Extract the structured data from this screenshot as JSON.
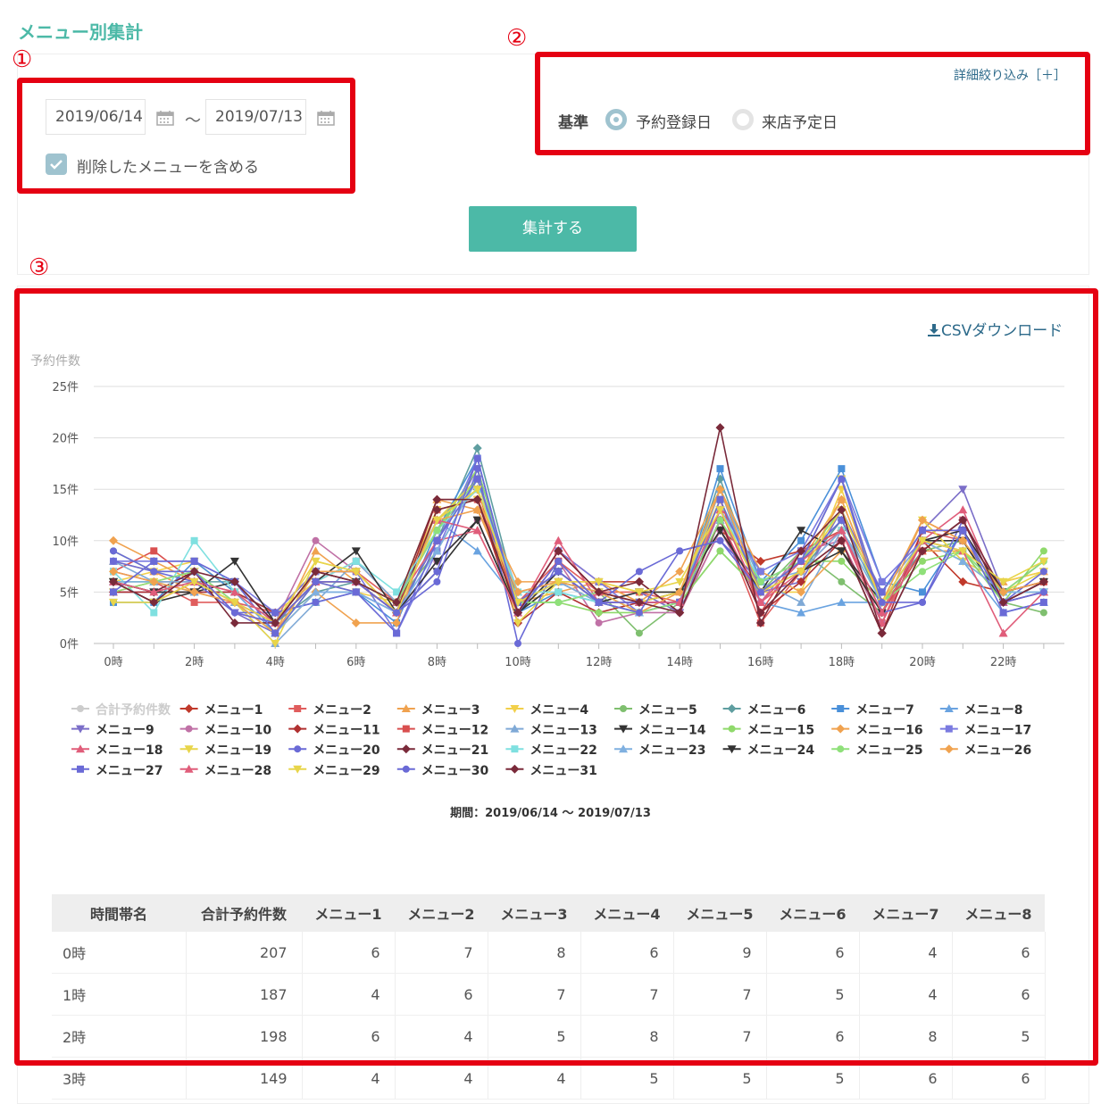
{
  "page": {
    "title": "メニュー別集計"
  },
  "annotations": [
    "①",
    "②",
    "③"
  ],
  "filters": {
    "start_date": "2019/06/14",
    "end_date": "2019/07/13",
    "separator": "〜",
    "include_deleted_label": "削除したメニューを含める",
    "include_deleted_checked": true,
    "detail_link": "詳細絞り込み［＋］",
    "basis_label": "基準",
    "basis_options": [
      "予約登録日",
      "来店予定日"
    ],
    "basis_selected": "予約登録日",
    "submit_label": "集計する"
  },
  "csv_link": "CSVダウンロード",
  "colors": {
    "accent": "#4cb9a7",
    "annotation": "#e50012",
    "link": "#2d6a8a"
  },
  "chart_data": {
    "type": "line",
    "ylabel": "予約件数",
    "ytick_labels": [
      "0件",
      "5件",
      "10件",
      "15件",
      "20件",
      "25件"
    ],
    "ylim": [
      0,
      25
    ],
    "x_categories": [
      "0時",
      "1時",
      "2時",
      "3時",
      "4時",
      "5時",
      "6時",
      "7時",
      "8時",
      "9時",
      "10時",
      "11時",
      "12時",
      "13時",
      "14時",
      "15時",
      "16時",
      "17時",
      "18時",
      "19時",
      "20時",
      "21時",
      "22時",
      "23時"
    ],
    "xtick_labels": [
      "0時",
      "2時",
      "4時",
      "6時",
      "8時",
      "10時",
      "12時",
      "14時",
      "16時",
      "18時",
      "20時",
      "22時"
    ],
    "grid": true,
    "legend_position": "bottom",
    "period_label": "期間：2019/06/14 〜 2019/07/13",
    "series": [
      {
        "name": "合計予約件数",
        "color": "#cccccc",
        "marker": "circle",
        "values": []
      },
      {
        "name": "メニュー1",
        "color": "#c0392b",
        "marker": "diamond",
        "values": [
          6,
          4,
          6,
          4,
          2,
          6,
          6,
          3,
          12,
          15,
          3,
          9,
          6,
          6,
          3,
          11,
          8,
          9,
          11,
          2,
          10,
          6,
          5,
          6
        ]
      },
      {
        "name": "メニュー2",
        "color": "#e05d5d",
        "marker": "square",
        "values": [
          7,
          6,
          4,
          4,
          3,
          7,
          7,
          4,
          13,
          14,
          4,
          8,
          5,
          5,
          4,
          12,
          2,
          7,
          10,
          2,
          11,
          10,
          4,
          6
        ]
      },
      {
        "name": "メニュー3",
        "color": "#f0a24f",
        "marker": "triangle",
        "values": [
          8,
          7,
          5,
          4,
          1,
          9,
          6,
          4,
          14,
          13,
          4,
          5,
          6,
          4,
          5,
          13,
          5,
          8,
          14,
          4,
          9,
          9,
          6,
          7
        ]
      },
      {
        "name": "メニュー4",
        "color": "#f2d04a",
        "marker": "triangle-down",
        "values": [
          6,
          7,
          8,
          5,
          3,
          6,
          5,
          4,
          13,
          14,
          3,
          6,
          6,
          5,
          5,
          14,
          5,
          5,
          15,
          4,
          10,
          8,
          6,
          7
        ]
      },
      {
        "name": "メニュー5",
        "color": "#7fbf6f",
        "marker": "circle",
        "values": [
          9,
          7,
          7,
          4,
          2,
          6,
          6,
          4,
          9,
          16,
          4,
          4,
          5,
          1,
          4,
          9,
          5,
          9,
          6,
          3,
          9,
          10,
          4,
          3
        ]
      },
      {
        "name": "メニュー6",
        "color": "#5f9ea0",
        "marker": "diamond",
        "values": [
          6,
          5,
          6,
          6,
          2,
          5,
          6,
          3,
          10,
          19,
          4,
          7,
          4,
          3,
          4,
          16,
          5,
          7,
          12,
          4,
          9,
          12,
          4,
          6
        ]
      },
      {
        "name": "メニュー7",
        "color": "#4a90d9",
        "marker": "square",
        "values": [
          4,
          4,
          8,
          5,
          3,
          4,
          5,
          2,
          11,
          18,
          3,
          5,
          4,
          4,
          4,
          17,
          6,
          10,
          17,
          6,
          5,
          11,
          4,
          5
        ]
      },
      {
        "name": "メニュー8",
        "color": "#6aa3e0",
        "marker": "triangle",
        "values": [
          6,
          6,
          5,
          5,
          1,
          5,
          5,
          3,
          12,
          9,
          4,
          6,
          4,
          3,
          4,
          15,
          4,
          3,
          4,
          4,
          10,
          8,
          3,
          4
        ]
      },
      {
        "name": "メニュー9",
        "color": "#7b6ec8",
        "marker": "triangle-down",
        "values": [
          5,
          5,
          7,
          3,
          1,
          7,
          7,
          3,
          10,
          17,
          4,
          7,
          4,
          5,
          3,
          13,
          5,
          6,
          13,
          5,
          11,
          15,
          5,
          5
        ]
      },
      {
        "name": "メニュー10",
        "color": "#c071a6",
        "marker": "circle",
        "values": [
          7,
          6,
          6,
          3,
          2,
          10,
          7,
          3,
          8,
          12,
          3,
          8,
          2,
          3,
          3,
          11,
          4,
          9,
          10,
          2,
          10,
          9,
          4,
          5
        ]
      },
      {
        "name": "メニュー11",
        "color": "#b03030",
        "marker": "diamond",
        "values": [
          5,
          5,
          5,
          5,
          3,
          7,
          7,
          3,
          14,
          14,
          2,
          5,
          3,
          4,
          4,
          12,
          3,
          6,
          10,
          1,
          11,
          11,
          5,
          6
        ]
      },
      {
        "name": "メニュー12",
        "color": "#d94f4f",
        "marker": "square",
        "values": [
          7,
          9,
          6,
          4,
          2,
          6,
          8,
          4,
          11,
          15,
          3,
          8,
          4,
          3,
          4,
          14,
          3,
          9,
          11,
          3,
          9,
          12,
          4,
          6
        ]
      },
      {
        "name": "メニュー13",
        "color": "#7fa9d6",
        "marker": "triangle",
        "values": [
          8,
          6,
          7,
          4,
          0,
          4,
          8,
          4,
          12,
          16,
          5,
          6,
          4,
          4,
          4,
          15,
          6,
          4,
          11,
          5,
          10,
          9,
          4,
          5
        ]
      },
      {
        "name": "メニュー14",
        "color": "#333333",
        "marker": "triangle-down",
        "values": [
          6,
          4,
          5,
          6,
          2,
          7,
          6,
          3,
          7,
          12,
          3,
          6,
          5,
          4,
          5,
          11,
          5,
          11,
          9,
          4,
          10,
          10,
          4,
          6
        ]
      },
      {
        "name": "メニュー15",
        "color": "#8fd96b",
        "marker": "circle",
        "values": [
          6,
          6,
          6,
          4,
          1,
          6,
          6,
          4,
          11,
          17,
          4,
          4,
          3,
          3,
          4,
          9,
          5,
          8,
          8,
          4,
          8,
          9,
          4,
          9
        ]
      },
      {
        "name": "メニュー16",
        "color": "#f0a24f",
        "marker": "diamond",
        "values": [
          10,
          8,
          6,
          4,
          1,
          5,
          2,
          2,
          13,
          14,
          6,
          6,
          6,
          4,
          7,
          15,
          7,
          5,
          9,
          3,
          12,
          10,
          5,
          5
        ]
      },
      {
        "name": "メニュー17",
        "color": "#7a7ae0",
        "marker": "square",
        "values": [
          8,
          8,
          8,
          6,
          3,
          7,
          7,
          1,
          9,
          18,
          3,
          9,
          6,
          3,
          4,
          13,
          7,
          9,
          16,
          6,
          10,
          11,
          4,
          5
        ]
      },
      {
        "name": "メニュー18",
        "color": "#e05d7a",
        "marker": "triangle",
        "values": [
          5,
          6,
          6,
          5,
          2,
          6,
          6,
          4,
          10,
          11,
          3,
          10,
          4,
          4,
          4,
          12,
          4,
          7,
          11,
          2,
          10,
          13,
          4,
          5
        ]
      },
      {
        "name": "メニュー19",
        "color": "#e8d54a",
        "marker": "triangle-down",
        "values": [
          5,
          6,
          7,
          4,
          0,
          8,
          7,
          3,
          12,
          16,
          2,
          6,
          5,
          4,
          5,
          14,
          5,
          8,
          16,
          4,
          12,
          8,
          5,
          7
        ]
      },
      {
        "name": "メニュー20",
        "color": "#6a6ad6",
        "marker": "circle",
        "values": [
          9,
          7,
          6,
          3,
          3,
          4,
          5,
          3,
          6,
          17,
          0,
          8,
          4,
          7,
          9,
          10,
          6,
          8,
          16,
          3,
          4,
          12,
          4,
          7
        ]
      },
      {
        "name": "メニュー21",
        "color": "#7a2a3a",
        "marker": "diamond",
        "values": [
          6,
          5,
          7,
          2,
          2,
          7,
          6,
          3,
          13,
          14,
          3,
          9,
          5,
          6,
          3,
          12,
          3,
          7,
          10,
          1,
          9,
          12,
          5,
          6
        ]
      },
      {
        "name": "メニュー22",
        "color": "#7fe0e0",
        "marker": "square",
        "values": [
          7,
          3,
          10,
          5,
          2,
          6,
          8,
          5,
          11,
          15,
          5,
          5,
          4,
          3,
          4,
          13,
          6,
          8,
          11,
          4,
          10,
          9,
          5,
          5
        ]
      },
      {
        "name": "メニュー23",
        "color": "#7fb0e0",
        "marker": "triangle",
        "values": [
          6,
          6,
          6,
          4,
          1,
          5,
          5,
          3,
          9,
          16,
          4,
          6,
          5,
          3,
          4,
          12,
          6,
          7,
          11,
          4,
          10,
          8,
          5,
          5
        ]
      },
      {
        "name": "メニュー24",
        "color": "#333333",
        "marker": "triangle-down",
        "values": [
          6,
          5,
          5,
          8,
          2,
          6,
          9,
          3,
          8,
          12,
          3,
          7,
          4,
          5,
          5,
          11,
          5,
          7,
          9,
          3,
          10,
          11,
          5,
          8
        ]
      },
      {
        "name": "メニュー25",
        "color": "#8fe07a",
        "marker": "circle",
        "values": [
          5,
          6,
          7,
          4,
          1,
          6,
          6,
          4,
          11,
          16,
          4,
          4,
          5,
          3,
          4,
          12,
          6,
          8,
          13,
          4,
          7,
          9,
          5,
          8
        ]
      },
      {
        "name": "メニュー26",
        "color": "#f0a24f",
        "marker": "diamond",
        "values": [
          7,
          6,
          5,
          4,
          1,
          7,
          7,
          3,
          12,
          13,
          5,
          6,
          5,
          3,
          5,
          15,
          5,
          7,
          14,
          4,
          12,
          10,
          5,
          6
        ]
      },
      {
        "name": "メニュー27",
        "color": "#6a6ad6",
        "marker": "square",
        "values": [
          5,
          8,
          8,
          6,
          1,
          6,
          5,
          1,
          10,
          16,
          4,
          7,
          4,
          4,
          4,
          14,
          5,
          8,
          12,
          5,
          11,
          11,
          3,
          4
        ]
      },
      {
        "name": "メニュー28",
        "color": "#e05d7a",
        "marker": "triangle",
        "values": [
          6,
          5,
          6,
          5,
          2,
          6,
          6,
          3,
          12,
          11,
          3,
          9,
          5,
          4,
          4,
          13,
          4,
          8,
          11,
          3,
          10,
          9,
          1,
          5
        ]
      },
      {
        "name": "メニュー29",
        "color": "#e8d54a",
        "marker": "triangle-down",
        "values": [
          4,
          4,
          6,
          4,
          2,
          8,
          7,
          3,
          12,
          15,
          4,
          6,
          6,
          5,
          6,
          13,
          5,
          7,
          13,
          4,
          10,
          9,
          6,
          8
        ]
      },
      {
        "name": "メニュー30",
        "color": "#6a6ad6",
        "marker": "circle",
        "values": [
          8,
          7,
          7,
          3,
          2,
          6,
          6,
          3,
          7,
          18,
          3,
          8,
          4,
          3,
          9,
          10,
          5,
          8,
          16,
          4,
          4,
          11,
          4,
          5
        ]
      },
      {
        "name": "メニュー31",
        "color": "#7a2a3a",
        "marker": "diamond",
        "values": [
          6,
          4,
          7,
          6,
          2,
          7,
          6,
          4,
          14,
          14,
          3,
          9,
          5,
          4,
          3,
          21,
          2,
          9,
          13,
          1,
          9,
          12,
          4,
          6
        ]
      }
    ]
  },
  "table": {
    "columns": [
      "時間帯名",
      "合計予約件数",
      "メニュー1",
      "メニュー2",
      "メニュー3",
      "メニュー4",
      "メニュー5",
      "メニュー6",
      "メニュー7",
      "メニュー8"
    ],
    "rows": [
      [
        "0時",
        "207",
        "6",
        "7",
        "8",
        "6",
        "9",
        "6",
        "4",
        "6"
      ],
      [
        "1時",
        "187",
        "4",
        "6",
        "7",
        "7",
        "7",
        "5",
        "4",
        "6"
      ],
      [
        "2時",
        "198",
        "6",
        "4",
        "5",
        "8",
        "7",
        "6",
        "8",
        "5"
      ],
      [
        "3時",
        "149",
        "4",
        "4",
        "4",
        "5",
        "5",
        "5",
        "6",
        "6"
      ]
    ]
  }
}
